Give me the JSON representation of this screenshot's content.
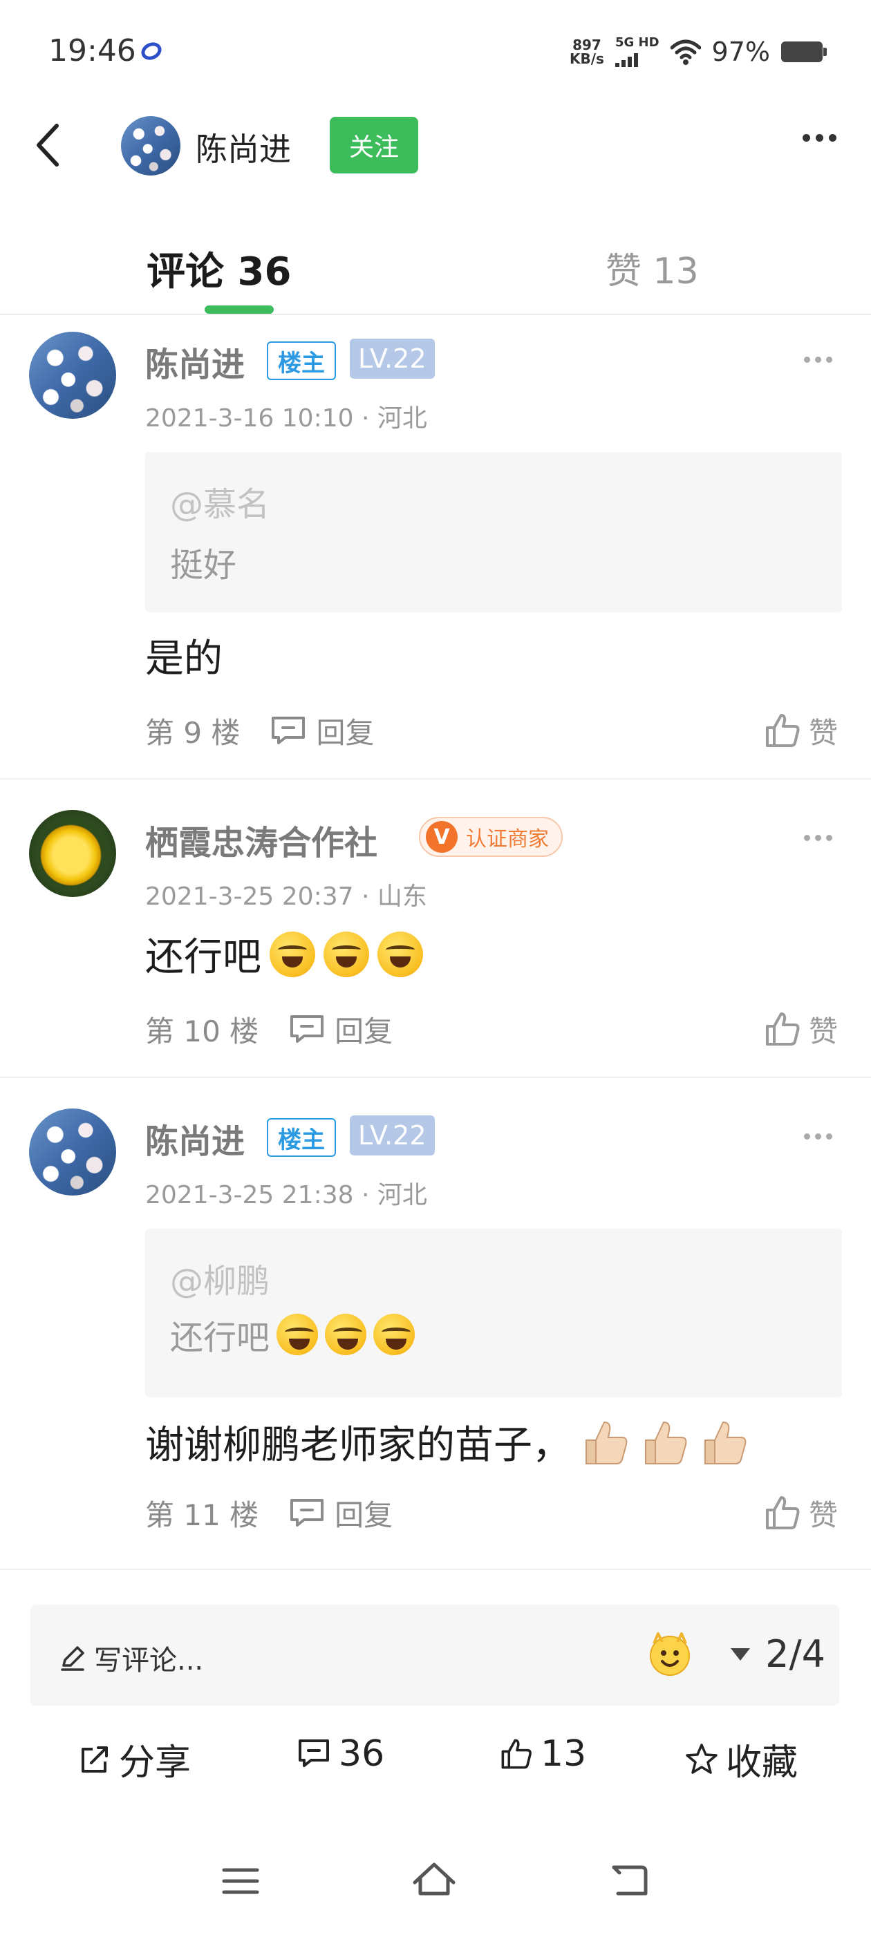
{
  "status_bar": {
    "time": "19:46",
    "net_speed_value": "897",
    "net_speed_unit": "KB/s",
    "signal_label": "5G HD",
    "battery": "97%"
  },
  "header": {
    "user_name": "陈尚进",
    "follow_label": "关注"
  },
  "tabs": {
    "comments_label": "评论 36",
    "likes_label": "赞 13"
  },
  "comments": [
    {
      "name": "陈尚进",
      "owner_badge": "楼主",
      "level_badge": "LV.22",
      "date": "2021-3-16 10:10",
      "location": "河北",
      "quote_at": "@慕名",
      "quote_text": "挺好",
      "text": "是的",
      "floor": "第 9 楼",
      "reply": "回复",
      "like": "赞"
    },
    {
      "name": "栖霞忠涛合作社",
      "merchant_v": "V",
      "merchant_badge": "认证商家",
      "date": "2021-3-25 20:37",
      "location": "山东",
      "text": "还行吧",
      "floor": "第 10 楼",
      "reply": "回复",
      "like": "赞"
    },
    {
      "name": "陈尚进",
      "owner_badge": "楼主",
      "level_badge": "LV.22",
      "date": "2021-3-25 21:38",
      "location": "河北",
      "quote_at": "@柳鹏",
      "quote_text": "还行吧",
      "text": "谢谢柳鹏老师家的苗子，",
      "floor": "第 11 楼",
      "reply": "回复",
      "like": "赞"
    }
  ],
  "input_bar": {
    "placeholder": "写评论...",
    "page_indicator": "2/4"
  },
  "actions": {
    "share": "分享",
    "comments_count": "36",
    "likes_count": "13",
    "favorite": "收藏"
  },
  "colors": {
    "accent_green": "#3dbc5c",
    "owner_blue": "#2b9ae3",
    "merchant_orange": "#ef7b35"
  }
}
